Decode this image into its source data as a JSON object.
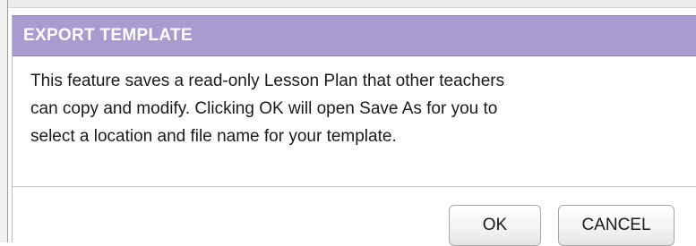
{
  "dialog": {
    "title": "EXPORT TEMPLATE",
    "message_lines": [
      "This feature saves a read-only Lesson Plan that other teachers",
      "can copy and modify. Clicking OK will open Save As for you to",
      "select a location and file name for your template."
    ],
    "ok_label": "OK",
    "cancel_label": "CANCEL"
  },
  "colors": {
    "titlebar": "#a99ad0",
    "title_text": "#ffffff"
  }
}
